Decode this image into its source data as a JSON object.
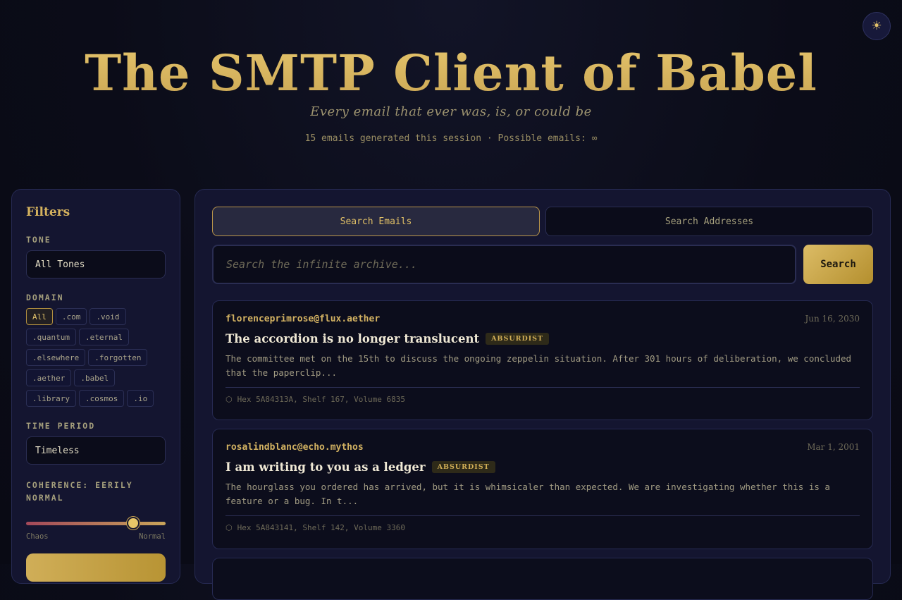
{
  "header": {
    "theme_icon": "sun-icon",
    "theme_glyph": "☀",
    "title": "The SMTP Client of Babel",
    "tagline": "Every email that ever was, is, or could be",
    "stats": "15 emails generated this session · Possible emails: ∞"
  },
  "filters": {
    "title": "Filters",
    "tone_label": "TONE",
    "tone_value": "All Tones",
    "domain_label": "DOMAIN",
    "domains": [
      "All",
      ".com",
      ".void",
      ".quantum",
      ".eternal",
      ".elsewhere",
      ".forgotten",
      ".aether",
      ".babel",
      ".library",
      ".cosmos",
      ".io"
    ],
    "active_domain": "All",
    "time_label": "TIME PERIOD",
    "time_value": "Timeless",
    "coherence_label": "COHERENCE: EERILY NORMAL",
    "coherence_level": 0.77,
    "coherence_min_label": "Chaos",
    "coherence_max_label": "Normal"
  },
  "search": {
    "tabs": [
      {
        "label": "Search Emails",
        "active": true
      },
      {
        "label": "Search Addresses",
        "active": false
      }
    ],
    "placeholder": "Search the infinite archive...",
    "button_label": "Search"
  },
  "emails": [
    {
      "sender": "florenceprimrose@flux.aether",
      "date": "Jun 16, 2030",
      "subject": "The accordion is no longer translucent",
      "tone": "ABSURDIST",
      "preview": "The committee met on the 15th to discuss the ongoing zeppelin situation. After 301 hours of deliberation, we concluded that the paperclip...",
      "location_icon": "hexagon-icon",
      "location": "Hex 5A84313A, Shelf 167, Volume 6835"
    },
    {
      "sender": "rosalindblanc@echo.mythos",
      "date": "Mar 1, 2001",
      "subject": "I am writing to you as a ledger",
      "tone": "ABSURDIST",
      "preview": "The hourglass you ordered has arrived, but it is whimsicaler than expected. We are investigating whether this is a feature or a bug. In t...",
      "location_icon": "hexagon-icon",
      "location": "Hex 5A843141, Shelf 142, Volume 3360"
    }
  ],
  "colors": {
    "accent_gold": "#d8b560",
    "panel": "#141530",
    "background": "#0b0c18"
  }
}
